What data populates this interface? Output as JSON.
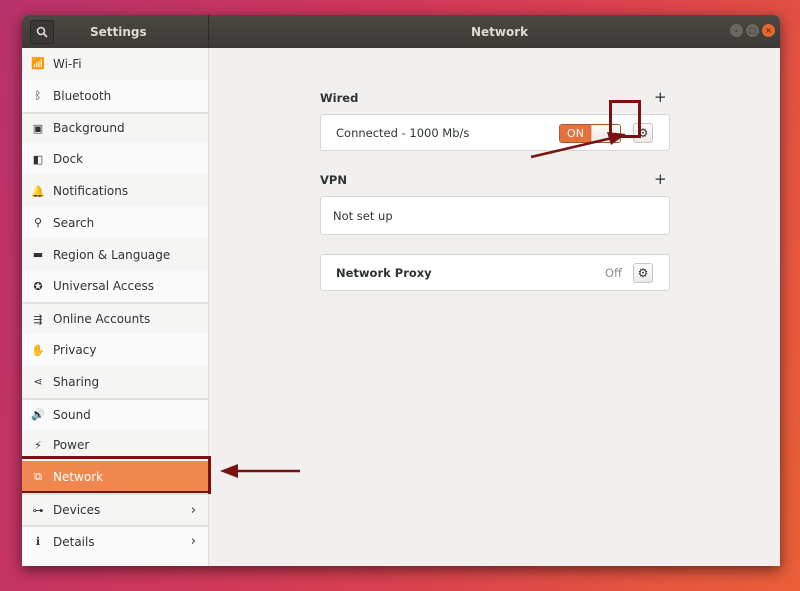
{
  "window": {
    "sidebar_title": "Settings",
    "panel_title": "Network",
    "controls": {
      "minimize": "–",
      "maximize": "□",
      "close": "×"
    }
  },
  "sidebar": {
    "items": [
      {
        "label": "Wi-Fi",
        "icon": "wifi-icon",
        "glyph": "📶"
      },
      {
        "label": "Bluetooth",
        "icon": "bluetooth-icon",
        "glyph": "ᛒ"
      },
      {
        "label": "Background",
        "icon": "background-icon",
        "glyph": "▣"
      },
      {
        "label": "Dock",
        "icon": "dock-icon",
        "glyph": "◧"
      },
      {
        "label": "Notifications",
        "icon": "bell-icon",
        "glyph": "🔔"
      },
      {
        "label": "Search",
        "icon": "search-icon",
        "glyph": "⚲"
      },
      {
        "label": "Region & Language",
        "icon": "flag-icon",
        "glyph": "▬"
      },
      {
        "label": "Universal Access",
        "icon": "accessibility-icon",
        "glyph": "✪"
      },
      {
        "label": "Online Accounts",
        "icon": "online-accounts-icon",
        "glyph": "⇶"
      },
      {
        "label": "Privacy",
        "icon": "hand-icon",
        "glyph": "✋"
      },
      {
        "label": "Sharing",
        "icon": "share-icon",
        "glyph": "⋖"
      },
      {
        "label": "Sound",
        "icon": "speaker-icon",
        "glyph": "🔊"
      },
      {
        "label": "Power",
        "icon": "power-icon",
        "glyph": "⚡"
      },
      {
        "label": "Network",
        "icon": "network-icon",
        "glyph": "⧉",
        "active": true
      },
      {
        "label": "Devices",
        "icon": "devices-icon",
        "glyph": "⊶",
        "chevron": "›"
      },
      {
        "label": "Details",
        "icon": "info-icon",
        "glyph": "ℹ",
        "chevron": "›"
      }
    ]
  },
  "network": {
    "wired": {
      "label": "Wired",
      "add": "+",
      "status": "Connected - 1000 Mb/s",
      "toggle_label": "ON",
      "toggle_state": true
    },
    "vpn": {
      "label": "VPN",
      "add": "+",
      "status": "Not set up"
    },
    "proxy": {
      "label": "Network Proxy",
      "status": "Off"
    }
  },
  "annotations": {
    "color": "#7a1212"
  }
}
